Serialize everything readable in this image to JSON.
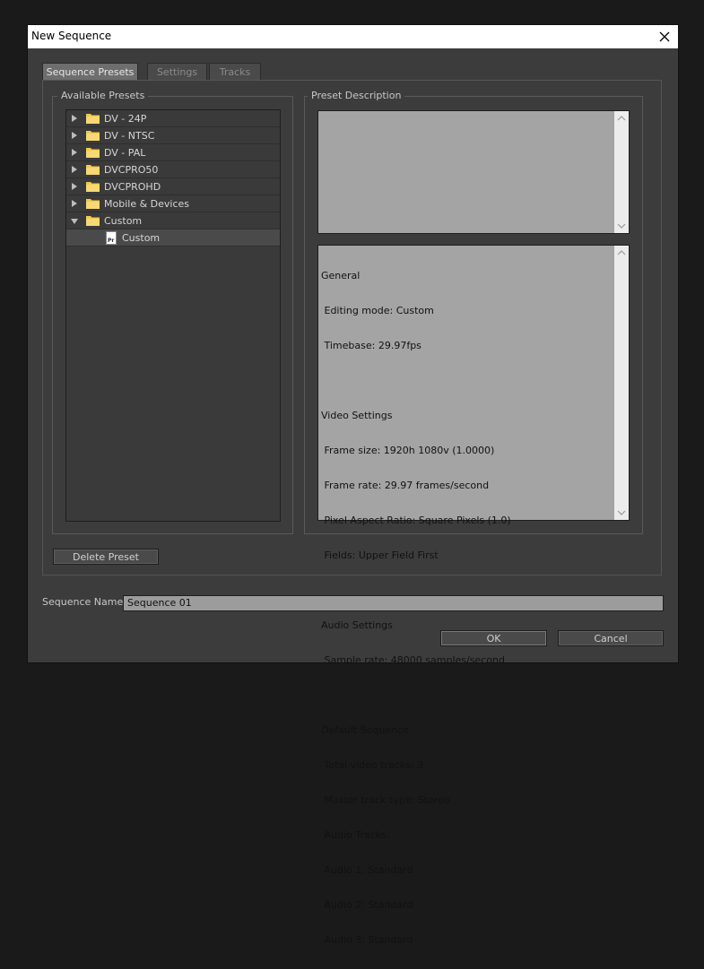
{
  "window": {
    "title": "New Sequence"
  },
  "tabs": [
    {
      "label": "Sequence Presets",
      "active": true
    },
    {
      "label": "Settings",
      "active": false
    },
    {
      "label": "Tracks",
      "active": false
    }
  ],
  "presets": {
    "group_label": "Available Presets",
    "items": [
      {
        "label": "DV - 24P",
        "expanded": false
      },
      {
        "label": "DV - NTSC",
        "expanded": false
      },
      {
        "label": "DV - PAL",
        "expanded": false
      },
      {
        "label": "DVCPRO50",
        "expanded": false
      },
      {
        "label": "DVCPROHD",
        "expanded": false
      },
      {
        "label": "Mobile & Devices",
        "expanded": false
      },
      {
        "label": "Custom",
        "expanded": true
      },
      {
        "label": "Custom",
        "child": true,
        "selected": true,
        "icon_text": "Pr"
      }
    ]
  },
  "description": {
    "group_label": "Preset Description",
    "text": "",
    "info_lines": [
      "General",
      " Editing mode: Custom",
      " Timebase: 29.97fps",
      "",
      "Video Settings",
      " Frame size: 1920h 1080v (1.0000)",
      " Frame rate: 29.97 frames/second",
      " Pixel Aspect Ratio: Square Pixels (1.0)",
      " Fields: Upper Field First",
      "",
      "Audio Settings",
      " Sample rate: 48000 samples/second",
      "",
      "Default Sequence",
      " Total video tracks: 3",
      " Master track type: Stereo",
      " Audio Tracks:",
      " Audio 1: Standard",
      " Audio 2: Standard",
      " Audio 3: Standard"
    ]
  },
  "buttons": {
    "delete_preset": "Delete Preset",
    "ok": "OK",
    "cancel": "Cancel"
  },
  "sequence_name": {
    "label": "Sequence Name:",
    "value": "Sequence 01"
  },
  "colors": {
    "dialog_bg": "#3c3c3c",
    "textbox_bg": "#a4a4a4",
    "folder": "#f2c94c"
  }
}
